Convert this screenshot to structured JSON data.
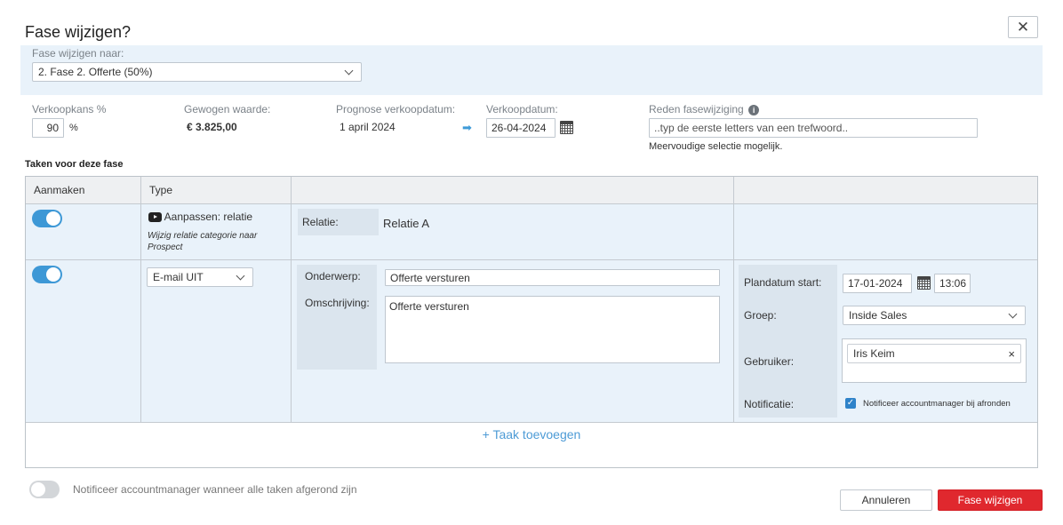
{
  "dialog": {
    "title": "Fase wijzigen?",
    "close_label": "✕"
  },
  "phase": {
    "label": "Fase wijzigen naar:",
    "selected": "2. Fase 2. Offerte (50%)"
  },
  "summary": {
    "chance_label": "Verkoopkans %",
    "chance_value": "90",
    "chance_unit": "%",
    "weighted_label": "Gewogen waarde:",
    "weighted_value": "€ 3.825,00",
    "forecast_label": "Prognose verkoopdatum:",
    "forecast_value": "1 april 2024",
    "sale_date_label": "Verkoopdatum:",
    "sale_date_value": "26-04-2024",
    "reason_label": "Reden fasewijziging",
    "reason_placeholder": "..typ de eerste letters van een trefwoord..",
    "reason_hint": "Meervoudige selectie mogelijk."
  },
  "tasks": {
    "heading": "Taken voor deze fase",
    "columns": [
      "Aanmaken",
      "Type",
      "",
      ""
    ],
    "row1": {
      "enabled": true,
      "type_label": "Aanpassen: relatie",
      "type_desc": "Wijzig relatie categorie naar Prospect",
      "field_label": "Relatie:",
      "field_value": "Relatie A"
    },
    "row2": {
      "enabled": true,
      "type_selected": "E-mail UIT",
      "subject_label": "Onderwerp:",
      "subject_value": "Offerte versturen",
      "description_label": "Omschrijving:",
      "description_value": "Offerte versturen",
      "start_label": "Plandatum start:",
      "start_date": "17-01-2024",
      "start_time": "13:06",
      "group_label": "Groep:",
      "group_selected": "Inside Sales",
      "user_label": "Gebruiker:",
      "user_tag": "Iris Keim",
      "user_tag_remove": "×",
      "notify_label": "Notificatie:",
      "notify_checkbox_label": "Notificeer accountmanager bij afronden",
      "notify_checked": true
    },
    "add_label": "+ Taak toevoegen"
  },
  "footer": {
    "notify_all_label": "Notificeer accountmanager wanneer alle taken afgerond zijn",
    "notify_all_enabled": false,
    "cancel_label": "Annuleren",
    "confirm_label": "Fase wijzigen"
  },
  "colors": {
    "accent": "#3d98d6",
    "primary_button": "#e0282e",
    "band": "#e9f2fa",
    "label_box": "#dbe5ee"
  }
}
